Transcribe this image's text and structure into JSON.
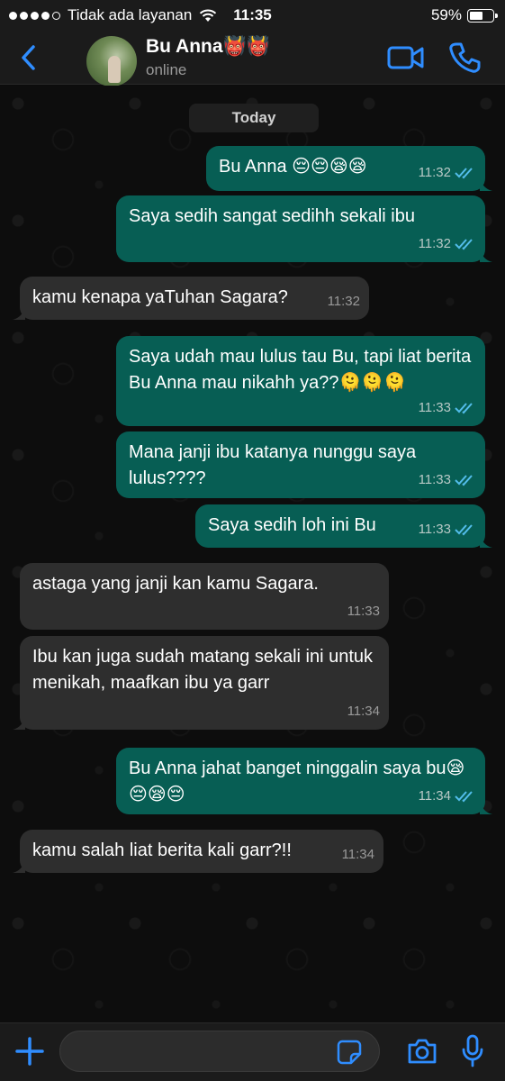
{
  "status_bar": {
    "carrier": "Tidak ada layanan",
    "time": "11:35",
    "battery_percent": "59%",
    "battery_level": 0.59
  },
  "header": {
    "back_icon": "chevron-left-icon",
    "contact_name": "Bu Anna👹👹",
    "contact_status": "online",
    "video_icon": "video-camera-icon",
    "phone_icon": "phone-icon"
  },
  "chat": {
    "date_label": "Today",
    "messages": [
      {
        "direction": "out",
        "text": "Bu Anna 😔😔😪😪",
        "time": "11:32",
        "read": true
      },
      {
        "direction": "out",
        "text": "Saya sedih sangat sedihh sekali ibu",
        "time": "11:32",
        "read": true
      },
      {
        "direction": "in",
        "text": "kamu kenapa yaTuhan Sagara?",
        "time": "11:32"
      },
      {
        "direction": "out",
        "text": "Saya udah mau lulus tau Bu, tapi liat berita Bu Anna mau nikahh ya??🫠🫠🫠",
        "time": "11:33",
        "read": true
      },
      {
        "direction": "out",
        "text": "Mana janji ibu katanya nunggu saya lulus????",
        "time": "11:33",
        "read": true
      },
      {
        "direction": "out",
        "text": "Saya sedih loh ini Bu",
        "time": "11:33",
        "read": true
      },
      {
        "direction": "in",
        "text": "astaga yang janji kan kamu Sagara.",
        "time": "11:33"
      },
      {
        "direction": "in",
        "text": "Ibu kan juga sudah matang sekali ini untuk menikah, maafkan ibu ya garr",
        "time": "11:34"
      },
      {
        "direction": "out",
        "text": "Bu Anna jahat banget ninggalin saya bu😪😔😪😔",
        "time": "11:34",
        "read": true
      },
      {
        "direction": "in",
        "text": "kamu salah liat berita kali garr?!!",
        "time": "11:34"
      }
    ]
  },
  "input_bar": {
    "plus_icon": "plus-icon",
    "input_value": "",
    "sticker_icon": "sticker-icon",
    "camera_icon": "camera-icon",
    "mic_icon": "microphone-icon"
  },
  "colors": {
    "accent_blue": "#2f8dff",
    "outgoing_bubble": "#075e54",
    "incoming_bubble": "#2e2e2e",
    "read_ticks": "#53bdeb"
  }
}
